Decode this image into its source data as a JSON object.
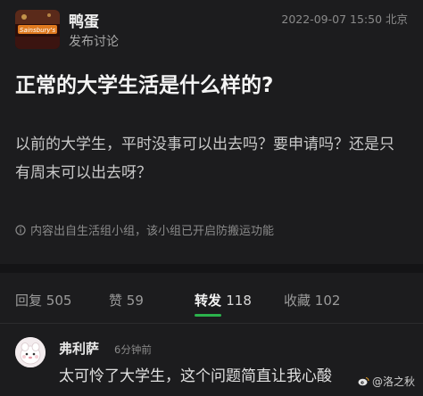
{
  "header": {
    "author_name": "鸭蛋",
    "author_subtitle": "发布讨论",
    "timestamp": "2022-09-07 15:50 北京",
    "avatar_logo_text": "Sainsbury's"
  },
  "post": {
    "title": "正常的大学生活是什么样的?",
    "body": "以前的大学生，平时没事可以出去吗？要申请吗？还是只有周末可以出去呀？",
    "source_note": "内容出自生活组小组，该小组已开启防搬运功能"
  },
  "tabs": [
    {
      "label": "回复",
      "count": "505",
      "active": false
    },
    {
      "label": "赞",
      "count": "59",
      "active": false
    },
    {
      "label": "转发",
      "count": "118",
      "active": true
    },
    {
      "label": "收藏",
      "count": "102",
      "active": false
    }
  ],
  "comment": {
    "author": "弗利萨",
    "time": "6分钟前",
    "text": "太可怜了大学生，这个问题简直让我心酸"
  },
  "watermark": "@洛之秋",
  "colors": {
    "background": "#1c1c1e",
    "accent": "#2bb24c"
  }
}
